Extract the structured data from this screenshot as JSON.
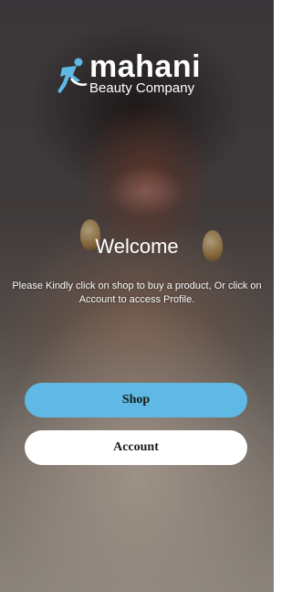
{
  "brand": {
    "name": "mahani",
    "tagline": "Beauty Company",
    "logo_icon": "running-figure-icon",
    "accent_color": "#5fb9e4"
  },
  "hero": {
    "background": "woman-portrait-photo",
    "welcome_title": "Welcome",
    "message": "Please Kindly click on shop to buy a product, Or click on Account to access Profile."
  },
  "actions": {
    "shop_label": "Shop",
    "shop_color": "#5fb9e4",
    "account_label": "Account",
    "account_color": "#ffffff"
  }
}
